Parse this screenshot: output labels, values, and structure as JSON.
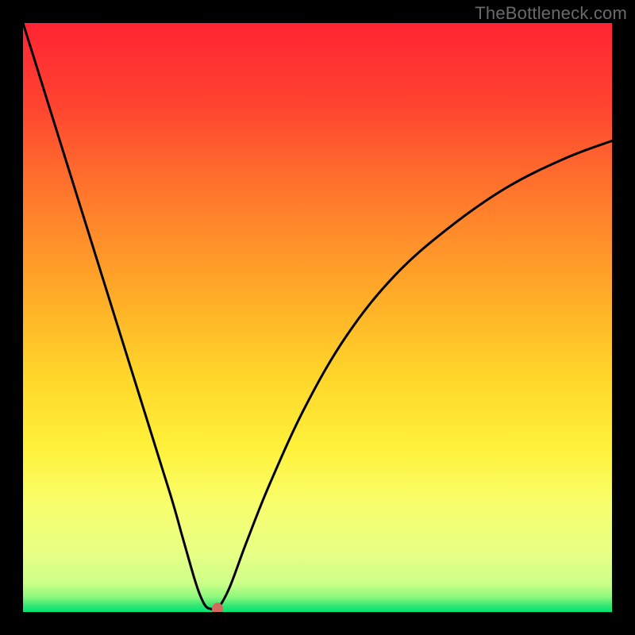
{
  "watermark": "TheBottleneck.com",
  "chart_data": {
    "type": "line",
    "title": "",
    "xlabel": "",
    "ylabel": "",
    "xlim": [
      0,
      100
    ],
    "ylim": [
      0,
      100
    ],
    "grid": false,
    "legend": false,
    "background_gradient": {
      "top_color": "#ff2a36",
      "mid_colors": [
        "#ff6a2d",
        "#ffb327",
        "#ffe733",
        "#f6ff70",
        "#ccff88"
      ],
      "bottom_color": "#00e676"
    },
    "series": [
      {
        "name": "curve",
        "color": "#000000",
        "x": [
          0,
          5,
          10,
          15,
          20,
          25,
          27,
          29,
          30,
          31,
          32,
          33,
          35,
          38,
          42,
          48,
          55,
          63,
          72,
          82,
          92,
          100
        ],
        "values": [
          100,
          84,
          68,
          52,
          36,
          20,
          13,
          6,
          3,
          1,
          0.5,
          0.5,
          4,
          12,
          22,
          35,
          47,
          57,
          65,
          72,
          77,
          80
        ]
      }
    ],
    "marker": {
      "name": "optimal-point",
      "x": 33,
      "y": 0.5,
      "rx": 7,
      "ry": 8,
      "color": "#d46a5e"
    }
  }
}
